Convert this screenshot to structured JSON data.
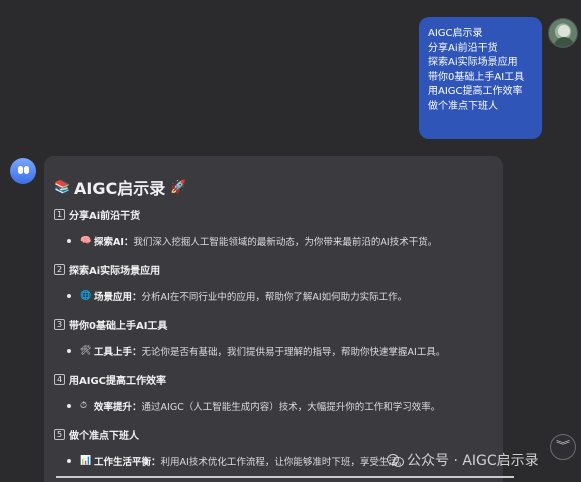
{
  "user_message": {
    "lines": [
      "AIGC启示录",
      "分享Ai前沿干货",
      "探索Ai实际场景应用",
      "带你0基础上手AI工具",
      "用AIGC提高工作效率",
      "做个准点下班人"
    ]
  },
  "bot_message": {
    "title_icon": "📚",
    "title": "AIGC启示录",
    "title_emoji": "🚀",
    "sections": [
      {
        "num": "1",
        "heading": "分享Ai前沿干货",
        "icon": "🧠",
        "label": "探索AI：",
        "text": "我们深入挖掘人工智能领域的最新动态，为你带来最前沿的AI技术干货。"
      },
      {
        "num": "2",
        "heading": "探索Ai实际场景应用",
        "icon": "🌐",
        "label": "场景应用：",
        "text": "分析AI在不同行业中的应用，帮助你了解AI如何助力实际工作。"
      },
      {
        "num": "3",
        "heading": "带你0基础上手AI工具",
        "icon": "🛠",
        "label": "工具上手：",
        "text": "无论你是否有基础，我们提供易于理解的指导，帮助你快速掌握AI工具。"
      },
      {
        "num": "4",
        "heading": "用AIGC提高工作效率",
        "icon": "⏱",
        "label": "效率提升：",
        "text": "通过AIGC（人工智能生成内容）技术，大幅提升你的工作和学习效率。"
      },
      {
        "num": "5",
        "heading": "做个准点下班人",
        "icon": "📊",
        "label": "工作生活平衡：",
        "text": "利用AI技术优化工作流程，让你能够准时下班，享受生活。"
      }
    ]
  },
  "watermark": {
    "text": "公众号 · AIGC启示录"
  },
  "scroll_button": {
    "icon": "chevron-double-down-icon"
  }
}
